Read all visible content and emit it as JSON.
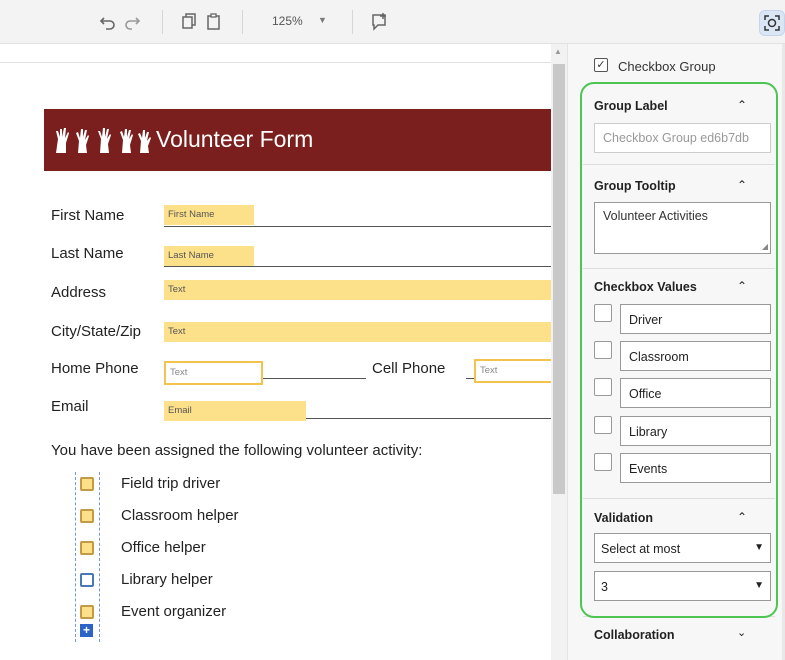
{
  "toolbar": {
    "undo_icon": "undo-icon",
    "redo_icon": "redo-icon",
    "copy_icon": "copy-icon",
    "paste_icon": "paste-icon",
    "zoom": "125%",
    "comment_icon": "add-comment-icon",
    "scan_icon": "scan-icon"
  },
  "document": {
    "banner_title": "Volunteer Form",
    "fields": {
      "first_name_label": "First Name",
      "first_name_field": "First Name",
      "last_name_label": "Last Name",
      "last_name_field": "Last Name",
      "address_label": "Address",
      "address_field": "Text",
      "city_label": "City/State/Zip",
      "city_field": "Text",
      "home_phone_label": "Home Phone",
      "home_phone_field": "Text",
      "cell_phone_label": "Cell Phone",
      "cell_phone_field": "Text",
      "email_label": "Email",
      "email_field": "Email"
    },
    "assignment_text": "You have been assigned the following volunteer activity:",
    "activities": [
      "Field trip driver",
      "Classroom helper",
      "Office helper",
      "Library helper",
      "Event organizer"
    ]
  },
  "panel": {
    "header_label": "Checkbox Group",
    "group_label_title": "Group Label",
    "group_label_value": "Checkbox Group ed6b7db",
    "group_tooltip_title": "Group Tooltip",
    "group_tooltip_value": "Volunteer Activities",
    "checkbox_values_title": "Checkbox Values",
    "checkbox_values": [
      "Driver",
      "Classroom",
      "Office",
      "Library",
      "Events"
    ],
    "validation_title": "Validation",
    "validation_rule": "Select at most",
    "validation_count": "3",
    "collaboration_title": "Collaboration"
  },
  "colors": {
    "banner": "#7b1f1e",
    "field_fill": "#fde08a",
    "highlight_frame": "#4cc552",
    "add_button": "#2b63c7"
  }
}
